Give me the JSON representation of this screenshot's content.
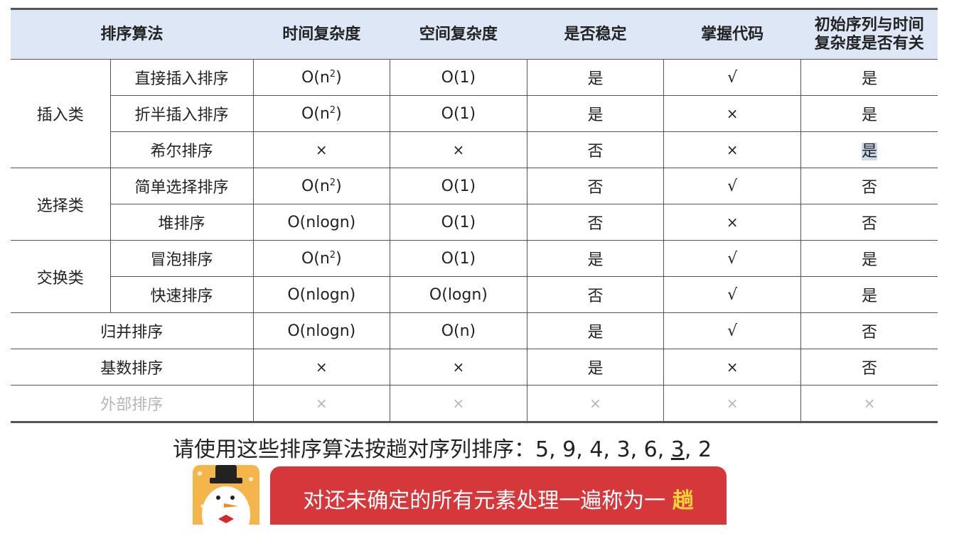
{
  "table": {
    "headers": [
      "排序算法",
      "时间复杂度",
      "空间复杂度",
      "是否稳定",
      "掌握代码",
      "初始序列与时间",
      "复杂度是否有关"
    ],
    "groups": [
      "插入类",
      "选择类",
      "交换类"
    ],
    "rows": [
      {
        "name": "直接插入排序",
        "time": "O(n",
        "time_sup": "2",
        "time_end": ")",
        "space": "O(1)",
        "stable": "是",
        "code": "√",
        "related": "是"
      },
      {
        "name": "折半插入排序",
        "time": "O(n",
        "time_sup": "2",
        "time_end": ")",
        "space": "O(1)",
        "stable": "是",
        "code": "×",
        "related": "是"
      },
      {
        "name": "希尔排序",
        "time": "×",
        "space": "×",
        "stable": "否",
        "code": "×",
        "related": "是"
      },
      {
        "name": "简单选择排序",
        "time": "O(n",
        "time_sup": "2",
        "time_end": ")",
        "space": "O(1)",
        "stable": "否",
        "code": "√",
        "related": "否"
      },
      {
        "name": "堆排序",
        "time": "O(nlogn)",
        "space": "O(1)",
        "stable": "否",
        "code": "×",
        "related": "否"
      },
      {
        "name": "冒泡排序",
        "time": "O(n",
        "time_sup": "2",
        "time_end": ")",
        "space": "O(1)",
        "stable": "是",
        "code": "√",
        "related": "是"
      },
      {
        "name": "快速排序",
        "time": "O(nlogn)",
        "space": "O(logn)",
        "stable": "否",
        "code": "√",
        "related": "是"
      },
      {
        "name": "归并排序",
        "time": "O(nlogn)",
        "space": "O(n)",
        "stable": "是",
        "code": "√",
        "related": "否"
      },
      {
        "name": "基数排序",
        "time": "×",
        "space": "×",
        "stable": "是",
        "code": "×",
        "related": "否"
      },
      {
        "name": "外部排序",
        "time": "×",
        "space": "×",
        "stable": "×",
        "code": "×",
        "related": "×"
      }
    ]
  },
  "question": {
    "prefix": "请使用这些排序算法按趟对序列排序：5, 9, 4, 3, 6, ",
    "underlined": "3",
    "suffix": ", 2"
  },
  "banner": {
    "text": "对还未确定的所有元素处理一遍称为一",
    "keyword": "趟"
  },
  "colors": {
    "header_bg": "#dde7f5",
    "banner_bg": "#d5373a",
    "keyword": "#ffd43a"
  }
}
